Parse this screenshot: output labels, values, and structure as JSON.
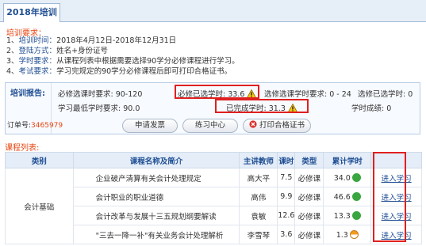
{
  "tab": {
    "title": "2018年培训"
  },
  "requirements": {
    "heading": "培训要求：",
    "items": [
      {
        "no": "1、",
        "key": "培训时间：",
        "text": "2018年4月12日-2018年12月31日"
      },
      {
        "no": "2、",
        "key": "登陆方式：",
        "text": "姓名+身份证号"
      },
      {
        "no": "3、",
        "key": "学时要求：",
        "text": "从课程列表中根据需要选择90学分必修课程进行学习。"
      },
      {
        "no": "4、",
        "key": "考试要求：",
        "text": "学习完规定的90学分必修课程后即可打印合格证书。"
      }
    ]
  },
  "report": {
    "label": "培训报告:",
    "order_label": "订单号:",
    "order_no": "3465979",
    "required_label": "必修选课时要求: 90-120",
    "selected_label": "必修已选学时: 33.6",
    "optional_req": "选修选课学时要求: 0 - 24",
    "optional_selected": "选修已选学时: 0",
    "min_hours": "学习最低学时要求: 90.0",
    "completed": "已完成学时: 31.3",
    "score": "学时成绩: 0"
  },
  "buttons": {
    "invoice": "申请发票",
    "practice": "练习中心",
    "print": "打印合格证书"
  },
  "courses": {
    "heading": "课程列表:",
    "columns": [
      "类别",
      "课程名称及简介",
      "主讲教师",
      "课时",
      "类型",
      "累计学时",
      ""
    ],
    "category": "会计基础",
    "rows": [
      {
        "name": "企业破产清算有关会计处理规定",
        "teacher": "高大平",
        "hours": "7.5",
        "type": "必修课",
        "total": "34.0",
        "status": "ok",
        "action": "进入学习"
      },
      {
        "name": "会计职业的职业道德",
        "teacher": "高伟",
        "hours": "9.9",
        "type": "必修课",
        "total": "46.6",
        "status": "ok",
        "action": "进入学习"
      },
      {
        "name": "会计改革与发展十三五规划纲要解读",
        "teacher": "袁敏",
        "hours": "12.6",
        "type": "必修课",
        "total": "13.3",
        "status": "ok",
        "action": "进入学习"
      },
      {
        "name": "\"三去一降一补\"有关业务会计处理解析",
        "teacher": "李雪琴",
        "hours": "3.6",
        "type": "必修课",
        "total": "1.3",
        "status": "half",
        "action": "进入学习"
      }
    ]
  }
}
